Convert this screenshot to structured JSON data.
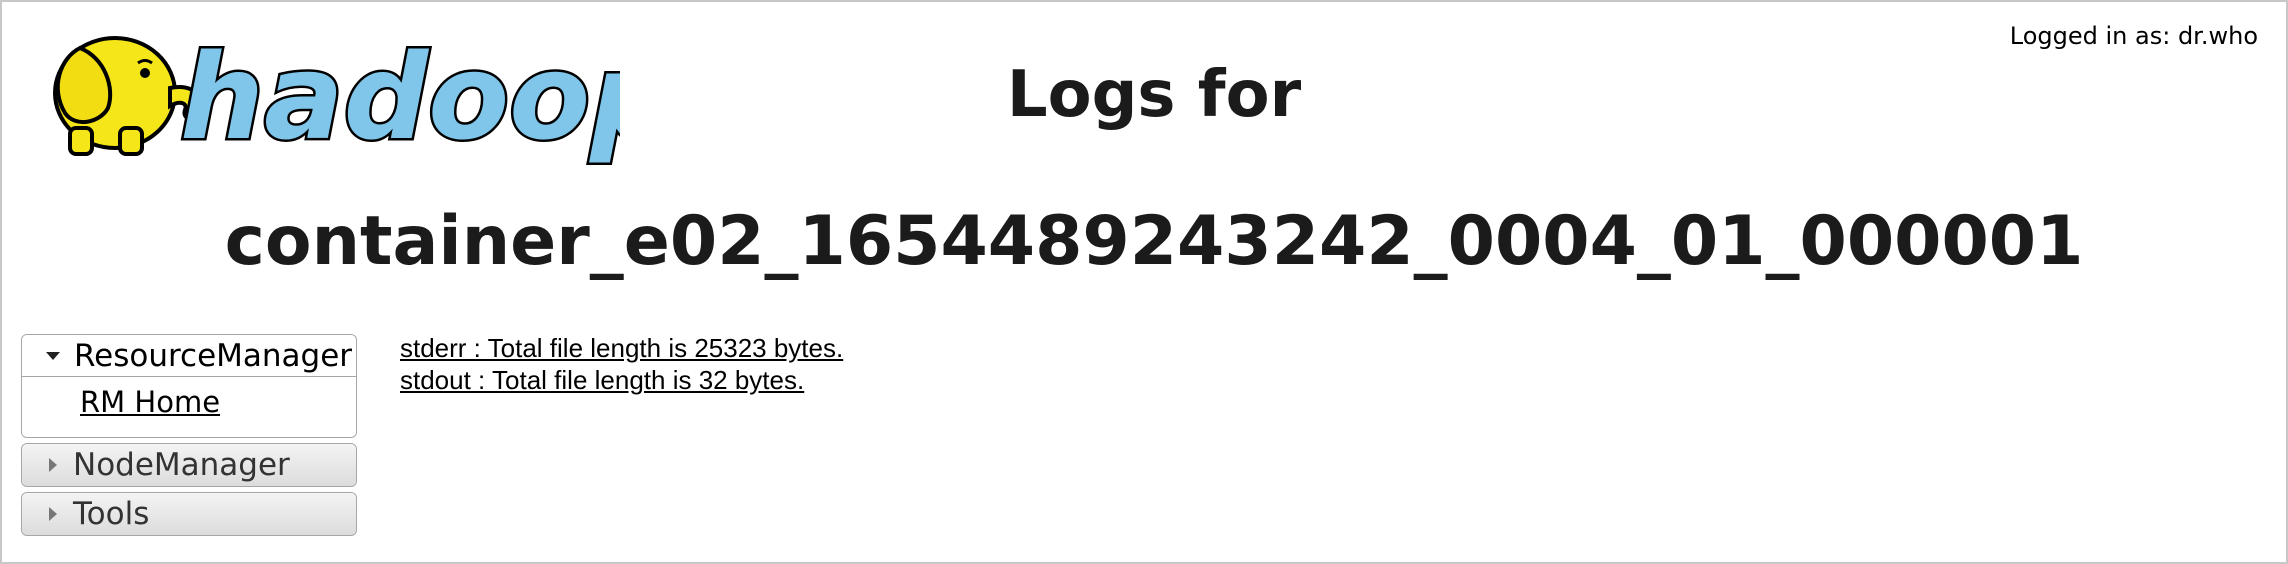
{
  "header": {
    "logged_in": "Logged in as: dr.who",
    "title_line1": "Logs for",
    "title_line2": "container_e02_1654489243242_0004_01_000001"
  },
  "logo": {
    "text": "hadoop",
    "icon": "elephant-icon",
    "colors": {
      "elephant": "#f5e61a",
      "text_fill": "#7fc6ea",
      "outline": "#000000"
    }
  },
  "nav": {
    "sections": [
      {
        "label": "ResourceManager",
        "expanded": true,
        "items": [
          {
            "label": "RM Home"
          }
        ]
      },
      {
        "label": "NodeManager",
        "expanded": false
      },
      {
        "label": "Tools",
        "expanded": false
      }
    ]
  },
  "logs": [
    {
      "label": "stderr : Total file length is 25323 bytes."
    },
    {
      "label": "stdout : Total file length is 32 bytes."
    }
  ]
}
